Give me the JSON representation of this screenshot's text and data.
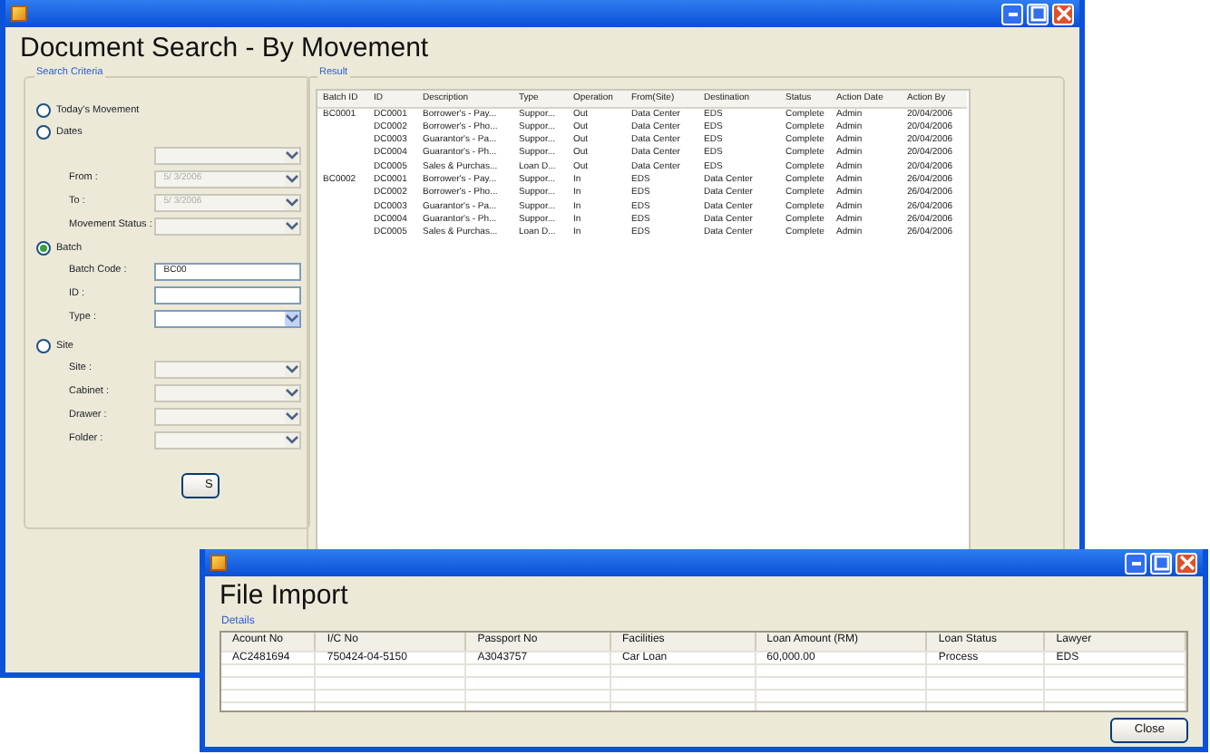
{
  "main_window": {
    "heading": "Document Search - By Movement",
    "search_criteria": {
      "legend": "Search Criteria",
      "options": [
        {
          "label": "Today's Movement",
          "selected": false
        },
        {
          "label": "Dates",
          "selected": false,
          "fields": [
            {
              "kind": "combo",
              "disabled": true
            },
            {
              "label": "From :",
              "value": "5/ 3/2006",
              "kind": "combo",
              "disabled": true
            },
            {
              "label": "To :",
              "value": "5/ 3/2006",
              "kind": "combo",
              "disabled": true
            },
            {
              "label": "Movement Status :",
              "kind": "combo",
              "disabled": true
            }
          ]
        },
        {
          "label": "Batch",
          "selected": true,
          "fields": [
            {
              "label": "Batch Code :",
              "value": "BC00",
              "kind": "text",
              "disabled": false
            },
            {
              "label": "ID :",
              "kind": "text",
              "disabled": false
            },
            {
              "label": "Type :",
              "kind": "combo",
              "disabled": false
            }
          ]
        },
        {
          "label": "Site",
          "selected": false,
          "fields": [
            {
              "label": "Site :",
              "kind": "combo",
              "disabled": true
            },
            {
              "label": "Cabinet :",
              "kind": "combo",
              "disabled": true
            },
            {
              "label": "Drawer :",
              "kind": "combo",
              "disabled": true
            },
            {
              "label": "Folder :",
              "kind": "combo",
              "disabled": true
            }
          ]
        }
      ],
      "search_button": "S"
    },
    "result": {
      "legend": "Result",
      "columns": [
        "Batch ID",
        "ID",
        "Description",
        "Type",
        "Operation",
        "From(Site)",
        "Destination",
        "Status",
        "Action Date",
        "Action By"
      ],
      "rows": [
        [
          "BC0001",
          "DC0001",
          "Borrower's - Pay...",
          "Suppor...",
          "Out",
          "Data Center",
          "EDS",
          "Complete",
          "Admin",
          "20/04/2006"
        ],
        [
          "",
          "DC0002",
          "Borrower's - Pho...",
          "Suppor...",
          "Out",
          "Data Center",
          "EDS",
          "Complete",
          "Admin",
          "20/04/2006"
        ],
        [
          "",
          "DC0003",
          "Guarantor's - Pa...",
          "Suppor...",
          "Out",
          "Data Center",
          "EDS",
          "Complete",
          "Admin",
          "20/04/2006"
        ],
        [
          "",
          "DC0004",
          "Guarantor's - Ph...",
          "Suppor...",
          "Out",
          "Data Center",
          "EDS",
          "Complete",
          "Admin",
          "20/04/2006"
        ],
        [
          "",
          "DC0005",
          "Sales & Purchas...",
          "Loan D...",
          "Out",
          "Data Center",
          "EDS",
          "Complete",
          "Admin",
          "20/04/2006"
        ],
        [
          "BC0002",
          "DC0001",
          "Borrower's - Pay...",
          "Suppor...",
          "In",
          "EDS",
          "Data Center",
          "Complete",
          "Admin",
          "26/04/2006"
        ],
        [
          "",
          "DC0002",
          "Borrower's - Pho...",
          "Suppor...",
          "In",
          "EDS",
          "Data Center",
          "Complete",
          "Admin",
          "26/04/2006"
        ],
        [
          "",
          "DC0003",
          "Guarantor's - Pa...",
          "Suppor...",
          "In",
          "EDS",
          "Data Center",
          "Complete",
          "Admin",
          "26/04/2006"
        ],
        [
          "",
          "DC0004",
          "Guarantor's - Ph...",
          "Suppor...",
          "In",
          "EDS",
          "Data Center",
          "Complete",
          "Admin",
          "26/04/2006"
        ],
        [
          "",
          "DC0005",
          "Sales & Purchas...",
          "Loan D...",
          "In",
          "EDS",
          "Data Center",
          "Complete",
          "Admin",
          "26/04/2006"
        ]
      ]
    }
  },
  "dialog": {
    "heading": "File Import",
    "legend": "Details",
    "columns": [
      "Acount No",
      "I/C No",
      "Passport No",
      "Facilities",
      "Loan Amount (RM)",
      "Loan Status",
      "Lawyer"
    ],
    "rows": [
      [
        "AC2481694",
        "750424-04-5150",
        "A3043757",
        "Car Loan",
        "60,000.00",
        "Process",
        "EDS"
      ]
    ],
    "close_button": "Close"
  }
}
